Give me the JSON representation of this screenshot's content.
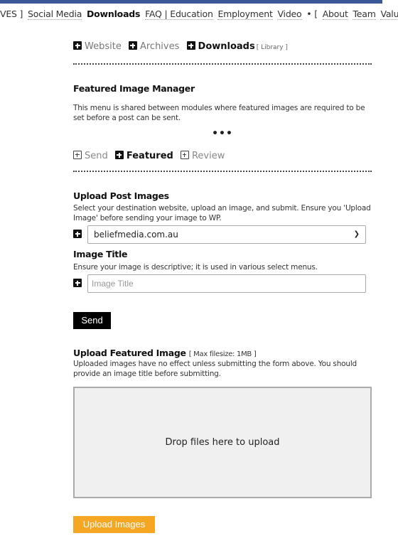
{
  "nav": {
    "items": [
      {
        "label": "VES ]",
        "bold": false,
        "link": false
      },
      {
        "label": "Social Media",
        "bold": false,
        "link": true
      },
      {
        "label": "Downloads",
        "bold": true,
        "link": false
      },
      {
        "label": "FAQ | Education",
        "bold": false,
        "link": true
      },
      {
        "label": "Employment",
        "bold": false,
        "link": true
      },
      {
        "label": "Video",
        "bold": false,
        "link": true
      },
      {
        "label": "• [",
        "bold": false,
        "link": false
      },
      {
        "label": "About",
        "bold": false,
        "link": true
      },
      {
        "label": "Team",
        "bold": false,
        "link": true
      },
      {
        "label": "Values",
        "bold": false,
        "link": true
      }
    ],
    "icons": [
      "user-secret-icon",
      "share-arrow-icon"
    ],
    "close_bracket": "]"
  },
  "top_tabs": {
    "items": [
      {
        "label": "Website",
        "active": false
      },
      {
        "label": "Archives",
        "active": false
      },
      {
        "label": "Downloads",
        "active": true,
        "sub": "[ Library ]"
      }
    ]
  },
  "featured_manager": {
    "title": "Featured Image Manager",
    "description": "This menu is shared between modules where featured images are required to be set before a post can be sent.",
    "ellipsis": "•••"
  },
  "sub_tabs": {
    "items": [
      {
        "label": "Send",
        "active": false
      },
      {
        "label": "Featured",
        "active": true
      },
      {
        "label": "Review",
        "active": false
      }
    ]
  },
  "upload_post_images": {
    "title": "Upload Post Images",
    "description": "Select your destination website, upload an image, and submit. Ensure you 'Upload Image' before sending your image to WP.",
    "selected_site": "beliefmedia.com.au"
  },
  "image_title": {
    "title": "Image Title",
    "description": "Ensure your image is descriptive; it is used in various select menus.",
    "placeholder": "Image Title",
    "value": ""
  },
  "send_label": "Send",
  "upload_featured": {
    "title": "Upload Featured Image",
    "max_size": "[ Max filesize: 1MB ]",
    "description": "Uploaded images have no effect unless submitting the form above. You should provide an image title before submitting.",
    "dropzone_text": "Drop files here to upload",
    "button_label": "Upload Images"
  },
  "colors": {
    "topbar": "#3b5998",
    "upload_button": "#f5a623",
    "send_button": "#000000"
  }
}
